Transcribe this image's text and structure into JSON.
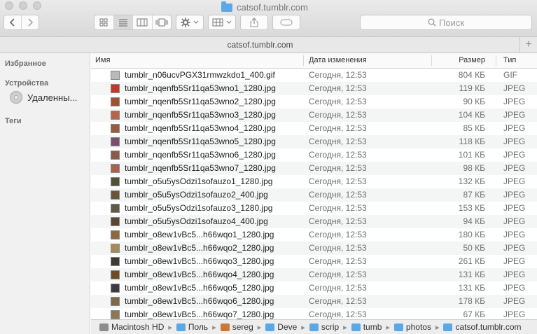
{
  "window": {
    "title": "catsof.tumblr.com",
    "path_title": "catsof.tumblr.com"
  },
  "toolbar": {
    "back_icon": "chevron-left-icon",
    "forward_icon": "chevron-right-icon",
    "search_placeholder": "Поиск"
  },
  "sidebar": {
    "favorites_header": "Избранное",
    "devices_header": "Устройства",
    "device_item": "Удаленны...",
    "tags_header": "Теги"
  },
  "columns": {
    "name": "Имя",
    "date": "Дата изменения",
    "size": "Размер",
    "kind": "Тип"
  },
  "files": [
    {
      "name": "tumblr_n06ucvPGX31rmwzkdo1_400.gif",
      "date": "Сегодня, 12:53",
      "size": "804 КБ",
      "kind": "GIF",
      "thumb": "#b9b9b9"
    },
    {
      "name": "tumblr_nqenfb5Sr11qa53wno1_1280.jpg",
      "date": "Сегодня, 12:53",
      "size": "119 КБ",
      "kind": "JPEG",
      "thumb": "#c0392b"
    },
    {
      "name": "tumblr_nqenfb5Sr11qa53wno2_1280.jpg",
      "date": "Сегодня, 12:53",
      "size": "90 КБ",
      "kind": "JPEG",
      "thumb": "#a0522d"
    },
    {
      "name": "tumblr_nqenfb5Sr11qa53wno3_1280.jpg",
      "date": "Сегодня, 12:53",
      "size": "104 КБ",
      "kind": "JPEG",
      "thumb": "#b5654a"
    },
    {
      "name": "tumblr_nqenfb5Sr11qa53wno4_1280.jpg",
      "date": "Сегодня, 12:53",
      "size": "85 КБ",
      "kind": "JPEG",
      "thumb": "#9c5a3c"
    },
    {
      "name": "tumblr_nqenfb5Sr11qa53wno5_1280.jpg",
      "date": "Сегодня, 12:53",
      "size": "118 КБ",
      "kind": "JPEG",
      "thumb": "#7a4e6e"
    },
    {
      "name": "tumblr_nqenfb5Sr11qa53wno6_1280.jpg",
      "date": "Сегодня, 12:53",
      "size": "101 КБ",
      "kind": "JPEG",
      "thumb": "#8b5a4a"
    },
    {
      "name": "tumblr_nqenfb5Sr11qa53wno7_1280.jpg",
      "date": "Сегодня, 12:53",
      "size": "98 КБ",
      "kind": "JPEG",
      "thumb": "#a8624f"
    },
    {
      "name": "tumblr_o5u5ysOdzi1sofauzo1_1280.jpg",
      "date": "Сегодня, 12:53",
      "size": "132 КБ",
      "kind": "JPEG",
      "thumb": "#4f4f3a"
    },
    {
      "name": "tumblr_o5u5ysOdzi1sofauzo2_400.jpg",
      "date": "Сегодня, 12:53",
      "size": "87 КБ",
      "kind": "JPEG",
      "thumb": "#6a5538"
    },
    {
      "name": "tumblr_o5u5ysOdzi1sofauzo3_1280.jpg",
      "date": "Сегодня, 12:53",
      "size": "153 КБ",
      "kind": "JPEG",
      "thumb": "#5d5a45"
    },
    {
      "name": "tumblr_o5u5ysOdzi1sofauzo4_400.jpg",
      "date": "Сегодня, 12:53",
      "size": "94 КБ",
      "kind": "JPEG",
      "thumb": "#5a4632"
    },
    {
      "name": "tumblr_o8ew1vBc5...h66wqo1_1280.jpg",
      "date": "Сегодня, 12:53",
      "size": "180 КБ",
      "kind": "JPEG",
      "thumb": "#8a6a3e"
    },
    {
      "name": "tumblr_o8ew1vBc5...h66wqo2_1280.jpg",
      "date": "Сегодня, 12:53",
      "size": "50 КБ",
      "kind": "JPEG",
      "thumb": "#a88a5a"
    },
    {
      "name": "tumblr_o8ew1vBc5...h66wqo3_1280.jpg",
      "date": "Сегодня, 12:53",
      "size": "261 КБ",
      "kind": "JPEG",
      "thumb": "#3f3a30"
    },
    {
      "name": "tumblr_o8ew1vBc5...h66wqo4_1280.jpg",
      "date": "Сегодня, 12:53",
      "size": "131 КБ",
      "kind": "JPEG",
      "thumb": "#6e4b22"
    },
    {
      "name": "tumblr_o8ew1vBc5...h66wqo5_1280.jpg",
      "date": "Сегодня, 12:53",
      "size": "131 КБ",
      "kind": "JPEG",
      "thumb": "#3b3b45"
    },
    {
      "name": "tumblr_o8ew1vBc5...h66wqo6_1280.jpg",
      "date": "Сегодня, 12:53",
      "size": "178 КБ",
      "kind": "JPEG",
      "thumb": "#7d6a4a"
    },
    {
      "name": "tumblr_o8ew1vBc5...h66wqo7_1280.jpg",
      "date": "Сегодня, 12:53",
      "size": "67 КБ",
      "kind": "JPEG",
      "thumb": "#8e7752"
    }
  ],
  "breadcrumbs": [
    {
      "label": "Macintosh HD",
      "icon": "hard-drive-icon",
      "color": "#8c8c8c"
    },
    {
      "label": "Поль",
      "icon": "user-folder-icon",
      "color": "#5aa9e6"
    },
    {
      "label": "sereg",
      "icon": "home-icon",
      "color": "#c77a3a"
    },
    {
      "label": "Deve",
      "icon": "folder-icon",
      "color": "#5aa9e6"
    },
    {
      "label": "scrip",
      "icon": "folder-icon",
      "color": "#5aa9e6"
    },
    {
      "label": "tumb",
      "icon": "folder-icon",
      "color": "#5aa9e6"
    },
    {
      "label": "photos",
      "icon": "folder-icon",
      "color": "#5aa9e6"
    },
    {
      "label": "catsof.tumblr.com",
      "icon": "folder-icon",
      "color": "#5aa9e6"
    }
  ]
}
